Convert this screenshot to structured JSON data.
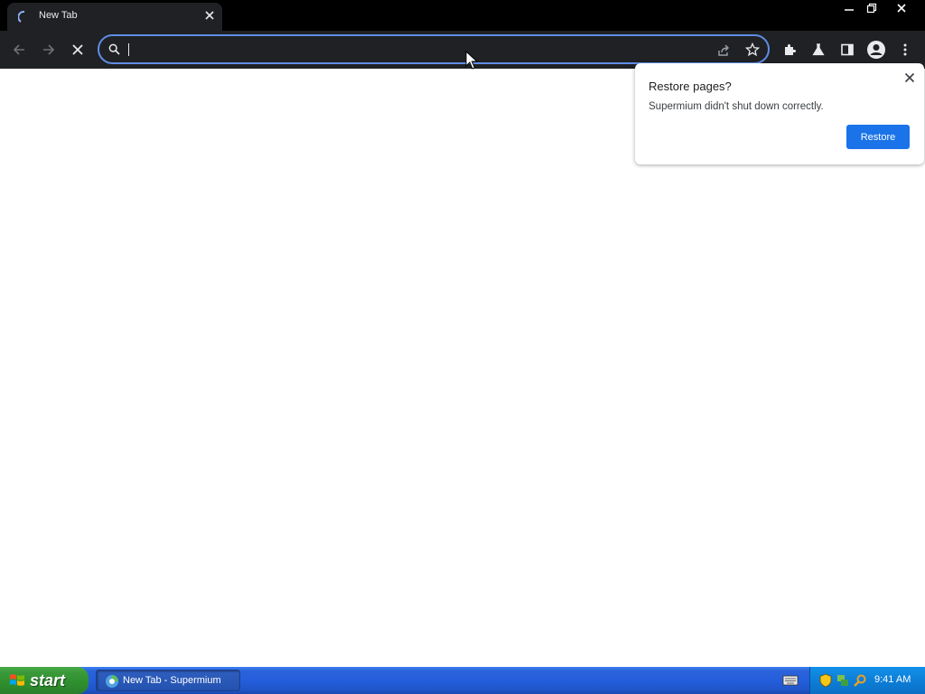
{
  "browser": {
    "tab": {
      "title": "New Tab"
    },
    "omnibox": {
      "value": ""
    }
  },
  "restore_bubble": {
    "title": "Restore pages?",
    "message": "Supermium didn't shut down correctly.",
    "button_label": "Restore"
  },
  "taskbar": {
    "start_label": "start",
    "task_label": "New Tab - Supermium",
    "clock": "9:41 AM"
  },
  "colors": {
    "accent": "#1a73e8",
    "chrome_bg": "#202124",
    "omnibox_border": "#5f8ee8",
    "taskbar_blue": "#245edc",
    "start_green": "#3a9a3a"
  },
  "icons": {
    "titlebar": [
      "minimize-icon",
      "restore-window-icon",
      "close-window-icon"
    ],
    "toolbar": [
      "back-icon",
      "forward-icon",
      "stop-icon",
      "search-icon",
      "share-icon",
      "star-icon",
      "extensions-icon",
      "labs-icon",
      "side-panel-icon",
      "profile-icon",
      "menu-icon"
    ],
    "tray": [
      "keyboard-icon",
      "security-shield-icon",
      "network-icon",
      "search-tray-icon"
    ]
  }
}
